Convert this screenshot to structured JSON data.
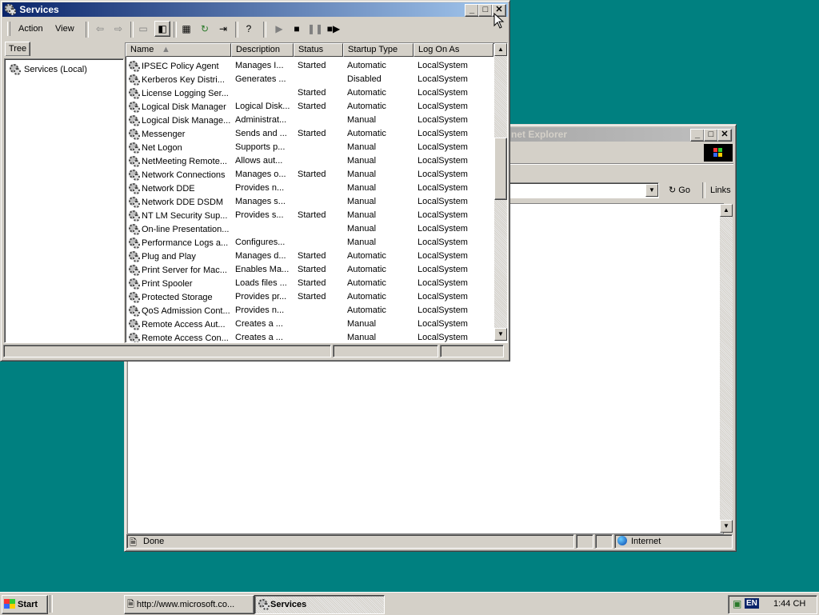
{
  "services_window": {
    "title": "Services",
    "menu": {
      "action": "Action",
      "view": "View"
    },
    "tree_tab": "Tree",
    "tree_root": "Services (Local)",
    "columns": [
      "Name",
      "Description",
      "Status",
      "Startup Type",
      "Log On As"
    ],
    "rows": [
      [
        "IPSEC Policy Agent",
        "Manages I...",
        "Started",
        "Automatic",
        "LocalSystem"
      ],
      [
        "Kerberos Key Distri...",
        "Generates ...",
        "",
        "Disabled",
        "LocalSystem"
      ],
      [
        "License Logging Ser...",
        "",
        "Started",
        "Automatic",
        "LocalSystem"
      ],
      [
        "Logical Disk Manager",
        "Logical Disk...",
        "Started",
        "Automatic",
        "LocalSystem"
      ],
      [
        "Logical Disk Manage...",
        "Administrat...",
        "",
        "Manual",
        "LocalSystem"
      ],
      [
        "Messenger",
        "Sends and ...",
        "Started",
        "Automatic",
        "LocalSystem"
      ],
      [
        "Net Logon",
        "Supports p...",
        "",
        "Manual",
        "LocalSystem"
      ],
      [
        "NetMeeting Remote...",
        "Allows aut...",
        "",
        "Manual",
        "LocalSystem"
      ],
      [
        "Network Connections",
        "Manages o...",
        "Started",
        "Manual",
        "LocalSystem"
      ],
      [
        "Network DDE",
        "Provides n...",
        "",
        "Manual",
        "LocalSystem"
      ],
      [
        "Network DDE DSDM",
        "Manages s...",
        "",
        "Manual",
        "LocalSystem"
      ],
      [
        "NT LM Security Sup...",
        "Provides s...",
        "Started",
        "Manual",
        "LocalSystem"
      ],
      [
        "On-line Presentation...",
        "",
        "",
        "Manual",
        "LocalSystem"
      ],
      [
        "Performance Logs a...",
        "Configures...",
        "",
        "Manual",
        "LocalSystem"
      ],
      [
        "Plug and Play",
        "Manages d...",
        "Started",
        "Automatic",
        "LocalSystem"
      ],
      [
        "Print Server for Mac...",
        "Enables Ma...",
        "Started",
        "Automatic",
        "LocalSystem"
      ],
      [
        "Print Spooler",
        "Loads files ...",
        "Started",
        "Automatic",
        "LocalSystem"
      ],
      [
        "Protected Storage",
        "Provides pr...",
        "Started",
        "Automatic",
        "LocalSystem"
      ],
      [
        "QoS Admission Cont...",
        "Provides n...",
        "",
        "Automatic",
        "LocalSystem"
      ],
      [
        "Remote Access Aut...",
        "Creates a ...",
        "",
        "Manual",
        "LocalSystem"
      ],
      [
        "Remote Access Con...",
        "Creates a ...",
        "",
        "Manual",
        "LocalSystem"
      ]
    ]
  },
  "ie_window": {
    "title": "net Explorer",
    "go_label": "Go",
    "links_label": "Links",
    "status_text": "Done",
    "zone_text": "Internet"
  },
  "taskbar": {
    "start_label": "Start",
    "tasks": [
      "http://www.microsoft.co...",
      "Services"
    ],
    "lang": "EN",
    "clock": "1:44 CH"
  },
  "colors": {
    "desktop": "#008080",
    "title_active": "#0a246a",
    "face": "#d4d0c8"
  }
}
